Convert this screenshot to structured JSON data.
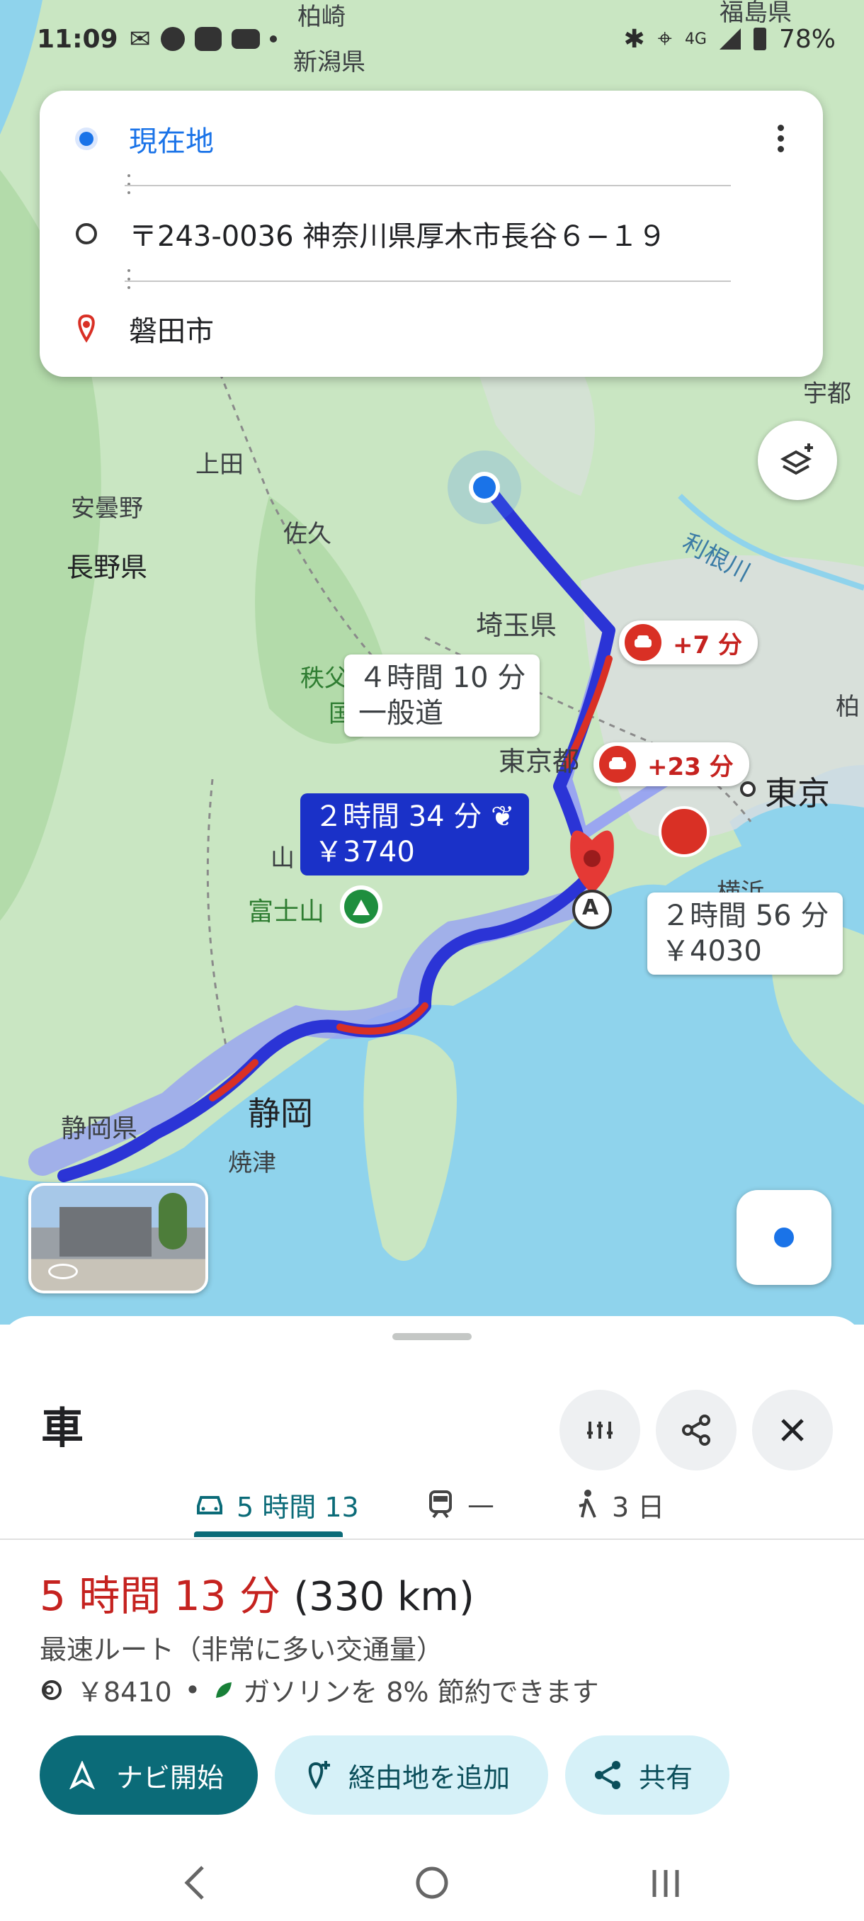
{
  "status_bar": {
    "time": "11:09",
    "network": "4G",
    "battery": "78%"
  },
  "directions": {
    "origin": "現在地",
    "waypoint": "〒243-0036 神奈川県厚木市長谷６−１９",
    "destination": "磐田市"
  },
  "map": {
    "place_labels": [
      "柏崎",
      "新潟県",
      "福島県",
      "宇都",
      "上田",
      "安曇野",
      "佐久",
      "長野県",
      "埼玉県",
      "利根川",
      "秩父",
      "国",
      "柏",
      "東京都",
      "東京",
      "山",
      "富士山",
      "横浜",
      "静岡県",
      "静岡",
      "焼津"
    ],
    "route_labels": {
      "alt1_time": "４時間 10 分",
      "alt1_sub": "一般道",
      "selected_time": "２時間 34 分",
      "selected_cost": "￥3740",
      "alt2_time": "２時間 56 分",
      "alt2_cost": "￥4030"
    },
    "traffic": [
      "+7 分",
      "+23 分"
    ],
    "waypoint_marker": "A"
  },
  "sheet": {
    "mode_title": "車",
    "tabs": [
      {
        "label": "5 時間 13",
        "icon": "car-icon"
      },
      {
        "label": "—",
        "icon": "train-icon"
      },
      {
        "label": "3 日",
        "icon": "walk-icon"
      }
    ],
    "summary_time": "5 時間 13 分",
    "summary_distance": "(330 km)",
    "summary_sub": "最速ルート（非常に多い交通量）",
    "toll": "￥8410",
    "eco": "ガソリンを 8% 節約できます",
    "buttons": {
      "start": "ナビ開始",
      "add_stop": "経由地を追加",
      "share": "共有"
    }
  },
  "colors": {
    "route_selected": "#2b34d6",
    "route_alt": "#9aa6f0",
    "traffic_red": "#d93025",
    "accent_teal": "#0b6b78",
    "water": "#8fd3ec",
    "land": "#c9e6c2"
  }
}
